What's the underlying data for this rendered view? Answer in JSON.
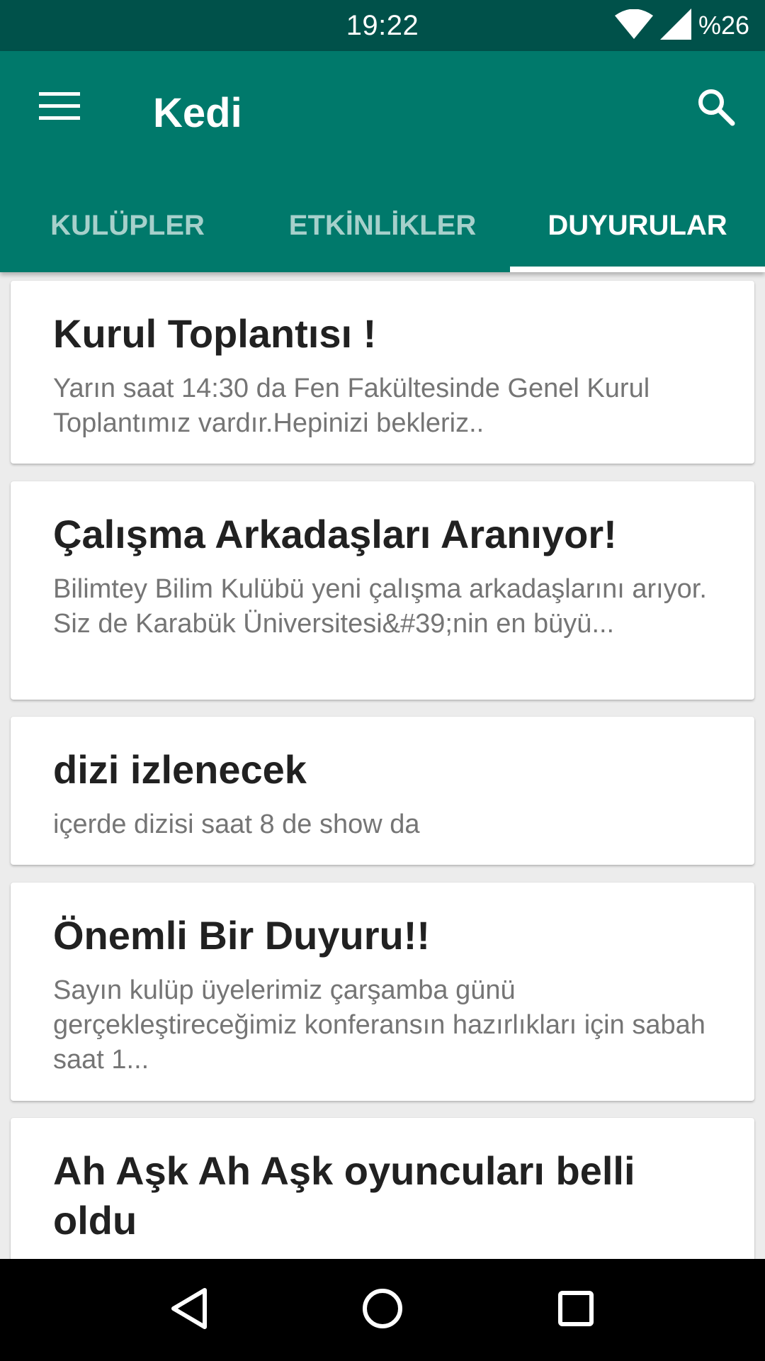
{
  "status_bar": {
    "time": "19:22",
    "battery": "%26",
    "icons": [
      "wifi-icon",
      "signal-icon"
    ]
  },
  "app_bar": {
    "title": "Kedi",
    "menu_icon": "menu-icon",
    "search_icon": "search-icon",
    "color": "#00796b",
    "status_color": "#00514a"
  },
  "tabs": [
    {
      "label": "KULÜPLER",
      "active": false
    },
    {
      "label": "ETKİNLİKLER",
      "active": false
    },
    {
      "label": "DUYURULAR",
      "active": true
    }
  ],
  "announcements": [
    {
      "title": "Kurul Toplantısı !",
      "body": "Yarın saat 14:30 da Fen Fakültesinde Genel Kurul Toplantımız vardır.Hepinizi bekleriz.."
    },
    {
      "title": "Çalışma Arkadaşları Aranıyor!",
      "body": "Bilimtey Bilim Kulübü yeni çalışma arkadaşlarını arıyor. Siz de Karabük Üniversitesi&#39;nin en büyü..."
    },
    {
      "title": "dizi izlenecek",
      "body": "içerde dizisi saat 8 de show da"
    },
    {
      "title": "Önemli Bir Duyuru!!",
      "body": "Sayın kulüp üyelerimiz çarşamba günü gerçekleştireceğimiz konferansın hazırlıkları için sabah saat 1..."
    },
    {
      "title": "Ah Aşk Ah Aşk  oyuncuları belli oldu",
      "body": ""
    }
  ],
  "nav_bar": {
    "icons": [
      "back-icon",
      "home-icon",
      "recents-icon"
    ]
  }
}
